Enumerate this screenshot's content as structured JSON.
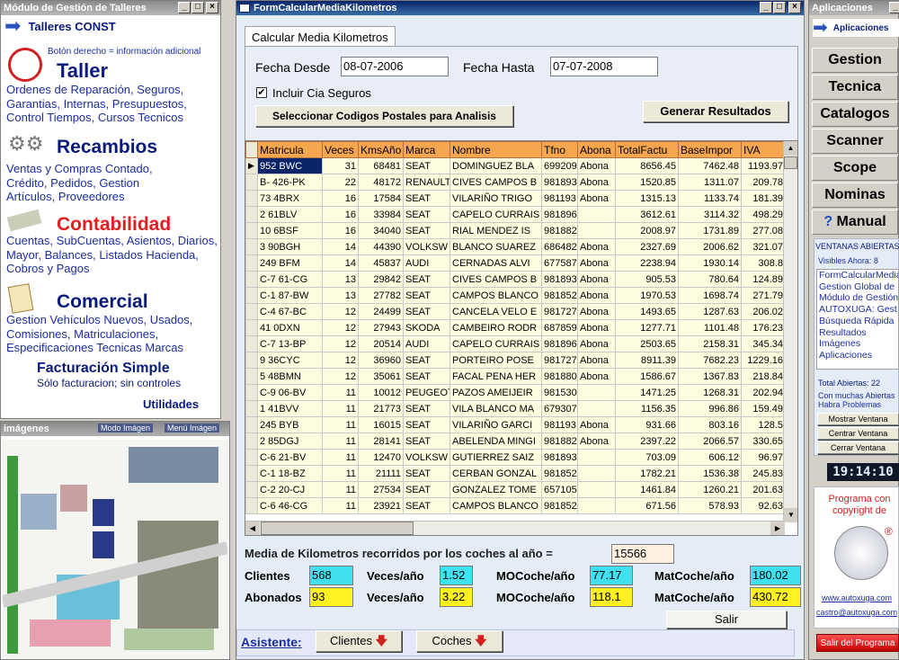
{
  "left": {
    "title": "Módulo de Gestión de Talleres",
    "header": "Talleres CONST",
    "hint": "Botón derecho = información adicional",
    "sections": [
      {
        "title": "Taller",
        "text": "Ordenes de Reparación, Seguros, Garantias, Internas, Presupuestos, Control Tiempos, Cursos Tecnicos"
      },
      {
        "title": "Recambios",
        "text": "Ventas y Compras Contado, Crédito, Pedidos, Gestion Artículos, Proveedores"
      },
      {
        "title": "Contabilidad",
        "text": "Cuentas, SubCuentas, Asientos, Diarios, Mayor, Balances, Listados Hacienda, Cobros y Pagos"
      },
      {
        "title": "Comercial",
        "text": "Gestion Vehículos Nuevos, Usados, Comisiones, Matriculaciones, Especificaciones Tecnicas Marcas"
      }
    ],
    "fact_title": "Facturación Simple",
    "fact_sub": "Sólo facturacion; sin controles",
    "utilidades": "Utilidades",
    "images_title": "imágenes",
    "modo_imagen": "Modo Imágen",
    "menu_imagen": "Menú Imágen"
  },
  "main": {
    "title": "FormCalcularMediaKilometros",
    "tab": "Calcular Media Kilometros",
    "fecha_desde_label": "Fecha Desde",
    "fecha_desde": "08-07-2006",
    "fecha_hasta_label": "Fecha Hasta",
    "fecha_hasta": "07-07-2008",
    "incluir_label": "Incluir Cia Seguros",
    "incluir_checked": true,
    "btn_postales": "Seleccionar Codigos Postales para Analisis",
    "btn_generar": "Generar Resultados",
    "columns": [
      "Matricula",
      "Veces",
      "KmsAño",
      "Marca",
      "Nombre",
      "Tfno",
      "Abona",
      "TotalFactu",
      "BaseImpor",
      "IVA"
    ],
    "rows": [
      [
        "952 BWC",
        "31",
        "68481",
        "SEAT",
        "DOMINGUEZ BLA",
        "699209",
        "Abona",
        "8656.45",
        "7462.48",
        "1193.97"
      ],
      [
        "B- 426-PK",
        "22",
        "48172",
        "RENAULT",
        "CIVES CAMPOS B",
        "981893",
        "Abona",
        "1520.85",
        "1311.07",
        "209.78"
      ],
      [
        "73 4BRX",
        "16",
        "17584",
        "SEAT",
        "VILARIÑO TRIGO",
        "981193",
        "Abona",
        "1315.13",
        "1133.74",
        "181.39"
      ],
      [
        "2 61BLV",
        "16",
        "33984",
        "SEAT",
        "CAPELO CURRAIS",
        "981896",
        "",
        "3612.61",
        "3114.32",
        "498.29"
      ],
      [
        "10 6BSF",
        "16",
        "34040",
        "SEAT",
        "RIAL MENDEZ IS",
        "981882",
        "",
        "2008.97",
        "1731.89",
        "277.08"
      ],
      [
        "3 90BGH",
        "14",
        "44390",
        "VOLKSW",
        "BLANCO SUAREZ",
        "686482",
        "Abona",
        "2327.69",
        "2006.62",
        "321.07"
      ],
      [
        "249 BFM",
        "14",
        "45837",
        "AUDI",
        "CERNADAS ALVI",
        "677587",
        "Abona",
        "2238.94",
        "1930.14",
        "308.8"
      ],
      [
        "C-7 61-CG",
        "13",
        "29842",
        "SEAT",
        "CIVES CAMPOS B",
        "981893",
        "Abona",
        "905.53",
        "780.64",
        "124.89"
      ],
      [
        "C-1 87-BW",
        "13",
        "27782",
        "SEAT",
        "CAMPOS BLANCO",
        "981852",
        "Abona",
        "1970.53",
        "1698.74",
        "271.79"
      ],
      [
        "C-4 67-BC",
        "12",
        "24499",
        "SEAT",
        "CANCELA VELO E",
        "981727",
        "Abona",
        "1493.65",
        "1287.63",
        "206.02"
      ],
      [
        "41 0DXN",
        "12",
        "27943",
        "SKODA",
        "CAMBEIRO RODR",
        "687859",
        "Abona",
        "1277.71",
        "1101.48",
        "176.23"
      ],
      [
        "C-7 13-BP",
        "12",
        "20514",
        "AUDI",
        "CAPELO CURRAIS",
        "981896",
        "Abona",
        "2503.65",
        "2158.31",
        "345.34"
      ],
      [
        "9 36CYC",
        "12",
        "36960",
        "SEAT",
        "PORTEIRO POSE",
        "981727",
        "Abona",
        "8911.39",
        "7682.23",
        "1229.16"
      ],
      [
        "5 48BMN",
        "12",
        "35061",
        "SEAT",
        "FACAL PENA HER",
        "981880",
        "Abona",
        "1586.67",
        "1367.83",
        "218.84"
      ],
      [
        "C-9 06-BV",
        "11",
        "10012",
        "PEUGEOT",
        "PAZOS AMEIJEIR",
        "981530",
        "",
        "1471.25",
        "1268.31",
        "202.94"
      ],
      [
        "1 41BVV",
        "11",
        "21773",
        "SEAT",
        "VILA BLANCO MA",
        "679307",
        "",
        "1156.35",
        "996.86",
        "159.49"
      ],
      [
        "245 BYB",
        "11",
        "16015",
        "SEAT",
        "VILARIÑO GARCI",
        "981193",
        "Abona",
        "931.66",
        "803.16",
        "128.5"
      ],
      [
        "2 85DGJ",
        "11",
        "28141",
        "SEAT",
        "ABELENDA MINGI",
        "981882",
        "Abona",
        "2397.22",
        "2066.57",
        "330.65"
      ],
      [
        "C-6 21-BV",
        "11",
        "12470",
        "VOLKSW",
        "GUTIERREZ SAIZ",
        "981893",
        "",
        "703.09",
        "606.12",
        "96.97"
      ],
      [
        "C-1 18-BZ",
        "11",
        "21111",
        "SEAT",
        "CERBAN GONZAL",
        "981852",
        "",
        "1782.21",
        "1536.38",
        "245.83"
      ],
      [
        "C-2 20-CJ",
        "11",
        "27534",
        "SEAT",
        "GONZALEZ TOME",
        "657105",
        "",
        "1461.84",
        "1260.21",
        "201.63"
      ],
      [
        "C-6 46-CG",
        "11",
        "23921",
        "SEAT",
        "CAMPOS BLANCO",
        "981852",
        "",
        "671.56",
        "578.93",
        "92.63"
      ]
    ],
    "media_label": "Media de Kilometros recorridos por los coches al año =",
    "media_value": "15566",
    "clientes_label": "Clientes",
    "clientes_value": "568",
    "abonados_label": "Abonados",
    "abonados_value": "93",
    "veces_label": "Veces/año",
    "veces_clientes": "1.52",
    "veces_abonados": "3.22",
    "mocoche_label": "MOCoche/año",
    "mocoche_clientes": "77.17",
    "mocoche_abonados": "118.1",
    "matcoche_label": "MatCoche/año",
    "matcoche_clientes": "180.02",
    "matcoche_abonados": "430.72",
    "salir": "Salir",
    "asistente": "Asistente:",
    "btn_clientes": "Clientes",
    "btn_coches": "Coches"
  },
  "right": {
    "title": "Aplicaciones",
    "header": "Aplicaciones",
    "buttons": [
      "Gestion",
      "Tecnica",
      "Catalogos",
      "Scanner",
      "Scope",
      "Nominas",
      "Manual"
    ],
    "ventanas_title": "VENTANAS ABIERTAS",
    "visibles": "Visibles Ahora: 8",
    "list": [
      "FormCalcularMedia",
      "Gestion Global de",
      "Módulo de Gestión",
      "AUTOXUGA: Gest",
      "Búsqueda Rápida",
      "Resultados",
      "Imágenes",
      "Aplicaciones"
    ],
    "total": "Total Abiertas: 22",
    "warning": "Con muchas Abiertas Habra Problemas",
    "mostrar": "Mostrar Ventana",
    "centrar": "Centrar Ventana",
    "cerrar": "Cerrar Ventana",
    "clock": "19:14:10",
    "copyright": "Programa con copyright de",
    "web": "www.autoxuga.com",
    "email": "castro@autoxuga.com",
    "salir": "Salir del Programa"
  }
}
